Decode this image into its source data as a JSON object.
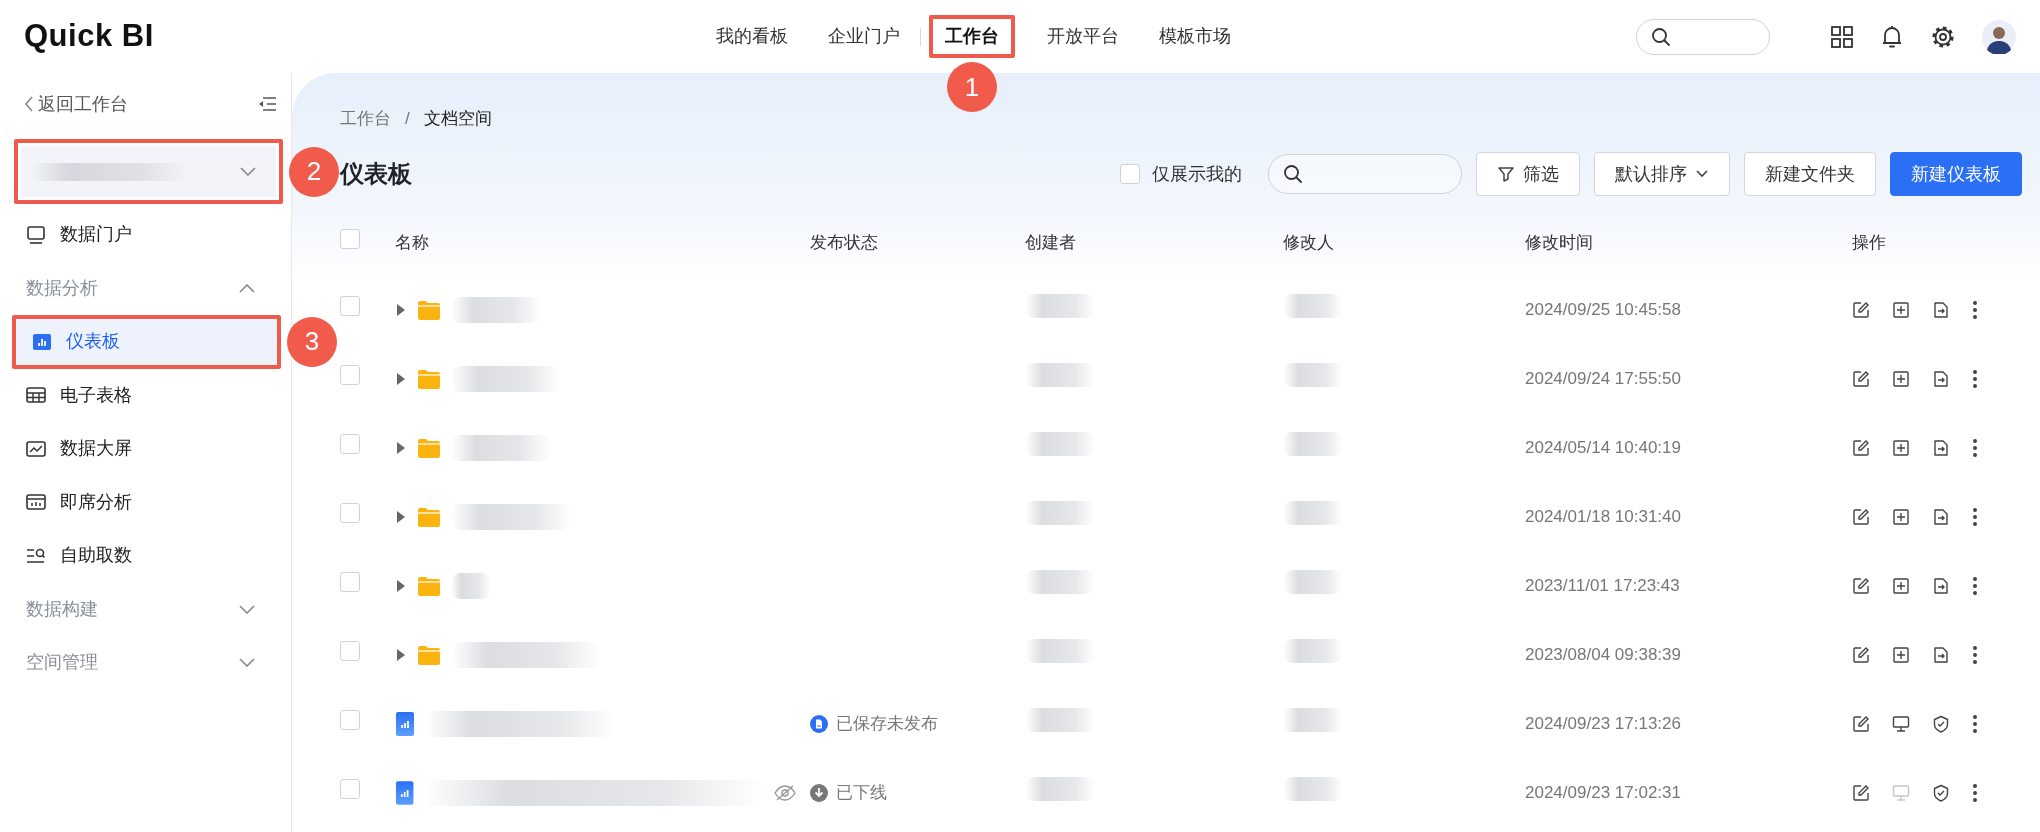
{
  "logo": "Quick BI",
  "top_nav": [
    {
      "label": "我的看板",
      "selected": false,
      "divider_before": false
    },
    {
      "label": "企业门户",
      "selected": false,
      "divider_before": false
    },
    {
      "label": "工作台",
      "selected": true,
      "divider_before": true,
      "callout": "1"
    },
    {
      "label": "开放平台",
      "selected": false,
      "divider_before": false
    },
    {
      "label": "模板市场",
      "selected": false,
      "divider_before": false
    }
  ],
  "sidebar": {
    "back": "返回工作台",
    "space_selector": {
      "callout": "2"
    },
    "items": [
      {
        "kind": "item",
        "label": "数据门户",
        "selected": false
      },
      {
        "kind": "group",
        "label": "数据分析",
        "expanded": true
      },
      {
        "kind": "item",
        "label": "仪表板",
        "selected": true,
        "callout": "3"
      },
      {
        "kind": "item",
        "label": "电子表格",
        "selected": false
      },
      {
        "kind": "item",
        "label": "数据大屏",
        "selected": false
      },
      {
        "kind": "item",
        "label": "即席分析",
        "selected": false
      },
      {
        "kind": "item",
        "label": "自助取数",
        "selected": false
      },
      {
        "kind": "group",
        "label": "数据构建",
        "expanded": false
      },
      {
        "kind": "group",
        "label": "空间管理",
        "expanded": false
      }
    ]
  },
  "breadcrumb": {
    "separator": "/",
    "items": [
      "工作台",
      "文档空间"
    ]
  },
  "page_title": "仪表板",
  "toolbar": {
    "only_mine": {
      "label": "仅展示我的",
      "checked": false
    },
    "buttons": [
      {
        "kind": "filter",
        "label": "筛选"
      },
      {
        "kind": "sort",
        "label": "默认排序"
      },
      {
        "kind": "plain",
        "label": "新建文件夹"
      },
      {
        "kind": "primary",
        "label": "新建仪表板"
      }
    ]
  },
  "table": {
    "select_all_checked": false,
    "columns": [
      "名称",
      "发布状态",
      "创建者",
      "修改人",
      "修改时间",
      "操作"
    ],
    "rows": [
      {
        "kind": "folder",
        "checked": false,
        "hidden": false,
        "modified": "2024/09/25 10:45:58",
        "actions": [
          {
            "kind": "edit",
            "disabled": false
          },
          {
            "kind": "add",
            "disabled": false
          },
          {
            "kind": "move",
            "disabled": false
          },
          {
            "kind": "more",
            "disabled": false
          }
        ]
      },
      {
        "kind": "folder",
        "checked": false,
        "hidden": false,
        "modified": "2024/09/24 17:55:50",
        "actions": [
          {
            "kind": "edit",
            "disabled": false
          },
          {
            "kind": "add",
            "disabled": false
          },
          {
            "kind": "move",
            "disabled": false
          },
          {
            "kind": "more",
            "disabled": false
          }
        ]
      },
      {
        "kind": "folder",
        "checked": false,
        "hidden": false,
        "modified": "2024/05/14 10:40:19",
        "actions": [
          {
            "kind": "edit",
            "disabled": false
          },
          {
            "kind": "add",
            "disabled": false
          },
          {
            "kind": "move",
            "disabled": false
          },
          {
            "kind": "more",
            "disabled": false
          }
        ]
      },
      {
        "kind": "folder",
        "checked": false,
        "hidden": false,
        "modified": "2024/01/18 10:31:40",
        "actions": [
          {
            "kind": "edit",
            "disabled": false
          },
          {
            "kind": "add",
            "disabled": false
          },
          {
            "kind": "move",
            "disabled": false
          },
          {
            "kind": "more",
            "disabled": false
          }
        ]
      },
      {
        "kind": "folder",
        "checked": false,
        "hidden": false,
        "modified": "2023/11/01 17:23:43",
        "actions": [
          {
            "kind": "edit",
            "disabled": false
          },
          {
            "kind": "add",
            "disabled": false
          },
          {
            "kind": "move",
            "disabled": false
          },
          {
            "kind": "more",
            "disabled": false
          }
        ]
      },
      {
        "kind": "folder",
        "checked": false,
        "hidden": false,
        "modified": "2023/08/04 09:38:39",
        "actions": [
          {
            "kind": "edit",
            "disabled": false
          },
          {
            "kind": "add",
            "disabled": false
          },
          {
            "kind": "move",
            "disabled": false
          },
          {
            "kind": "more",
            "disabled": false
          }
        ]
      },
      {
        "kind": "dashboard",
        "checked": false,
        "hidden": false,
        "status": {
          "kind": "saved",
          "label": "已保存未发布"
        },
        "modified": "2024/09/23 17:13:26",
        "actions": [
          {
            "kind": "edit",
            "disabled": false
          },
          {
            "kind": "screen",
            "disabled": false
          },
          {
            "kind": "shield",
            "disabled": false
          },
          {
            "kind": "more",
            "disabled": false
          }
        ]
      },
      {
        "kind": "dashboard",
        "checked": false,
        "hidden": true,
        "status": {
          "kind": "offline",
          "label": "已下线"
        },
        "modified": "2024/09/23 17:02:31",
        "actions": [
          {
            "kind": "edit",
            "disabled": false
          },
          {
            "kind": "screen",
            "disabled": true
          },
          {
            "kind": "shield",
            "disabled": false
          },
          {
            "kind": "more",
            "disabled": false
          }
        ]
      }
    ]
  }
}
